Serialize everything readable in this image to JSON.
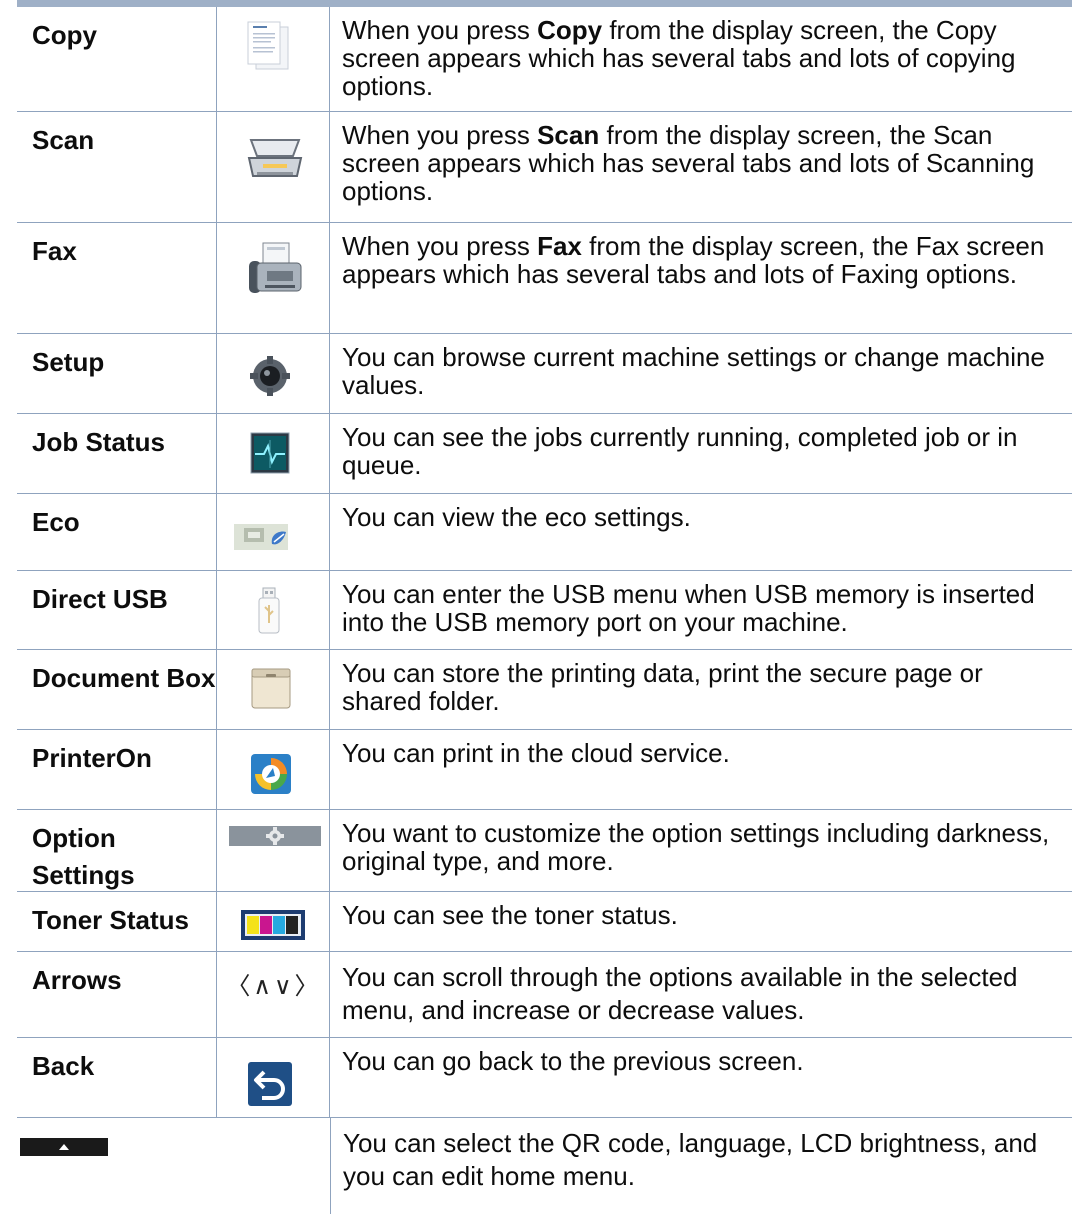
{
  "rows": [
    {
      "label": "Copy",
      "icon": "copy-document-icon",
      "desc_pre": "When you press ",
      "desc_bold": "Copy",
      "desc_post": " from the display screen, the Copy screen appears which has several tabs and lots of copying options."
    },
    {
      "label": "Scan",
      "icon": "scanner-icon",
      "desc_pre": "When you press ",
      "desc_bold": "Scan",
      "desc_post": " from the display screen, the Scan screen appears which has several tabs and lots of Scanning options."
    },
    {
      "label": "Fax",
      "icon": "fax-machine-icon",
      "desc_pre": "When you press ",
      "desc_bold": "Fax",
      "desc_post": " from the display screen, the Fax screen appears which has several tabs and lots of Faxing options."
    },
    {
      "label": "Setup",
      "icon": "gear-icon",
      "desc": "You can browse current machine settings or change machine values."
    },
    {
      "label": "Job Status",
      "icon": "job-status-monitor-icon",
      "desc": "You can see the jobs currently running, completed job or in queue."
    },
    {
      "label": "Eco",
      "icon": "eco-leaf-icon",
      "desc": "You can view the eco settings."
    },
    {
      "label": "Direct USB",
      "icon": "usb-drive-icon",
      "desc": "You can enter the USB menu when USB memory is inserted into the USB memory port on your machine."
    },
    {
      "label": "Document Box",
      "icon": "document-box-folder-icon",
      "desc": "You can store the printing data, print the secure page or shared folder."
    },
    {
      "label": "PrinterOn",
      "icon": "printeron-cloud-icon",
      "desc": "You can print in the cloud service."
    },
    {
      "label": "Option Settings",
      "icon": "option-settings-gear-icon",
      "desc": "You want to customize the option settings including darkness, original type, and more."
    },
    {
      "label": "Toner Status",
      "icon": "toner-cartridges-icon",
      "desc": "You can see the toner status."
    },
    {
      "label": "Arrows",
      "icon": "arrows-icon",
      "arrows_glyphs": "〈∧∨〉",
      "desc": "You can scroll through the options available in the selected menu, and increase or decrease values."
    },
    {
      "label": "Back",
      "icon": "back-arrow-icon",
      "desc": "You can go back to the previous screen."
    },
    {
      "icon": "up-triangle-bar-icon",
      "desc": "You can select the QR code, language, LCD brightness, and you can edit home menu."
    }
  ]
}
